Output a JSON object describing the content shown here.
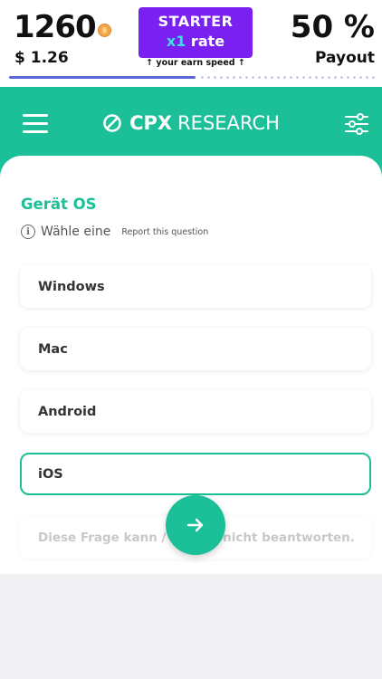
{
  "stats": {
    "coins": "1260",
    "usd": "$ 1.26",
    "level_name": "STARTER",
    "rate_multiplier": "x1",
    "rate_label": "rate",
    "earn_speed": "↑ your earn speed ↑",
    "percent": "50 %",
    "payout_label": "Payout",
    "progress_fraction": 0.5
  },
  "header": {
    "brand_bold": "CPX",
    "brand_light": "RESEARCH",
    "icons": [
      "menu-icon",
      "logo-icon",
      "filter-icon"
    ]
  },
  "question": {
    "title": "Gerät OS",
    "hint": "Wähle eine",
    "report_label": "Report this question"
  },
  "options": [
    {
      "label": "Windows",
      "selected": false
    },
    {
      "label": "Mac",
      "selected": false
    },
    {
      "label": "Android",
      "selected": false
    },
    {
      "label": "iOS",
      "selected": true
    },
    {
      "label": "Diese Frage kann / will ich nicht beantworten.",
      "selected": false
    }
  ],
  "colors": {
    "accent": "#1bbf98",
    "badge": "#7a21f2",
    "rate_highlight": "#3de0e0",
    "progress": "#5866d8"
  }
}
